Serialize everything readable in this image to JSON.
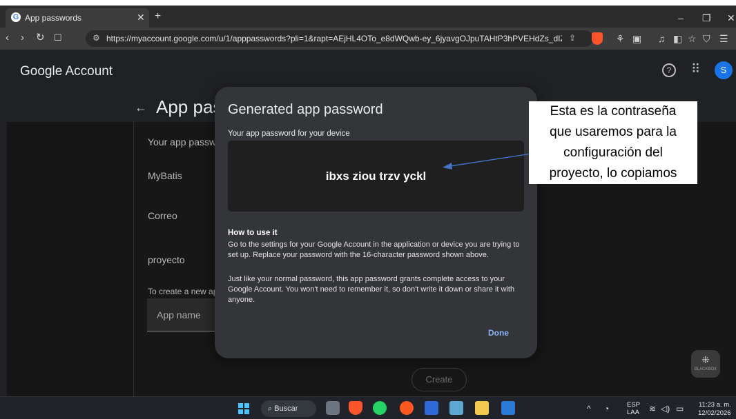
{
  "browser": {
    "tab_title": "App passwords",
    "tab_favicon": "G",
    "new_tab_icon": "+",
    "url": "https://myaccount.google.com/u/1/apppasswords?pli=1&rapt=AEjHL4OTo_e8dWQwb-ey_6jyavgOJpuTAHtP3hPVEHdZs_dIZe..."
  },
  "account_header": {
    "logo_text": "Google Account",
    "help_icon": "?",
    "avatar_letter": "S"
  },
  "page": {
    "title": "App pas",
    "intro_fragment": "Your app passw",
    "items": [
      "MyBatis",
      "Correo",
      "proyecto"
    ],
    "create_prompt": "To create a new ap",
    "app_name_label": "App name",
    "create_button": "Create",
    "blackbox_label": "BLACKBOX"
  },
  "dialog": {
    "title": "Generated app password",
    "subtitle": "Your app password for your device",
    "password": "ibxs ziou trzv yckl",
    "how_to_title": "How to use it",
    "how_to_p1": "Go to the settings for your Google Account in the application or device you are trying to set up. Replace your password with the 16-character password shown above.",
    "how_to_p2": "Just like your normal password, this app password grants complete access to your Google Account. You won't need to remember it, so don't write it down or share it with anyone.",
    "done_button": "Done"
  },
  "annotation": {
    "lines": [
      "Esta es la contraseña",
      "que usaremos para la",
      "configuración del",
      "proyecto, lo copiamos"
    ],
    "arrow_color": "#4472c4"
  },
  "taskbar": {
    "search_label": "Buscar",
    "lang_line1": "ESP",
    "lang_line2": "LAA",
    "time": "11:23 a. m.",
    "date": "12/02/2026"
  },
  "colors": {
    "accent_blue": "#8ab4f8",
    "avatar_blue": "#1a73e8",
    "dialog_bg": "#343538"
  }
}
